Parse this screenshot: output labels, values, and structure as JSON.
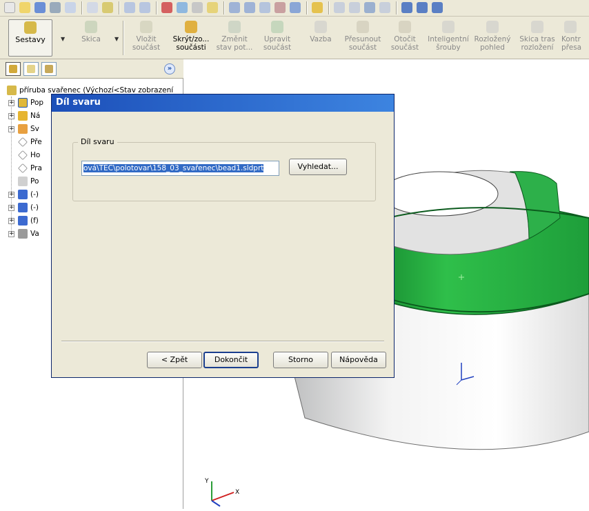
{
  "toolbar": {
    "sestavy": "Sestavy",
    "skica": "Skica",
    "items": [
      {
        "l1": "Vložit",
        "l2": "součást"
      },
      {
        "l1": "Skrýt/zo...",
        "l2": "součásti"
      },
      {
        "l1": "Změnit",
        "l2": "stav pot..."
      },
      {
        "l1": "Upravit",
        "l2": "součást"
      },
      {
        "l1": "Vazba",
        "l2": ""
      },
      {
        "l1": "Přesunout",
        "l2": "součást"
      },
      {
        "l1": "Otočit",
        "l2": "součást"
      },
      {
        "l1": "Inteligentní",
        "l2": "šrouby"
      },
      {
        "l1": "Rozložený",
        "l2": "pohled"
      },
      {
        "l1": "Skica tras",
        "l2": "rozložení"
      },
      {
        "l1": "Kontr",
        "l2": "přesa"
      }
    ]
  },
  "tree": {
    "root": "příruba svařenec (Výchozí<Stav zobrazení",
    "items": [
      {
        "label": "Pop",
        "icon": "annotations-icon"
      },
      {
        "label": "Ná",
        "icon": "design-binder-icon"
      },
      {
        "label": "Sv",
        "icon": "lights-icon"
      },
      {
        "label": "Pře",
        "icon": "plane-icon"
      },
      {
        "label": "Ho",
        "icon": "plane-icon"
      },
      {
        "label": "Pra",
        "icon": "plane-icon"
      },
      {
        "label": "Po",
        "icon": "origin-icon"
      },
      {
        "label": "(-)",
        "icon": "part-icon"
      },
      {
        "label": "(-)",
        "icon": "part-icon"
      },
      {
        "label": "(f)",
        "icon": "part-icon"
      },
      {
        "label": "Va",
        "icon": "mates-icon"
      }
    ],
    "expand_symbol": "»"
  },
  "dialog": {
    "title": "Díl svaru",
    "group_label": "Díl svaru",
    "path_value": "ová\\TEC\\polotovar\\158_03_svařenec\\bead1.sldprt",
    "browse_label": "Vyhledat...",
    "back_label": "< Zpět",
    "finish_label": "Dokončit",
    "cancel_label": "Storno",
    "help_label": "Nápověda"
  },
  "viewport": {
    "axis_x": "X",
    "axis_y": "Y",
    "accent_green": "#1f9d3a",
    "weld_color": "#22a83c"
  }
}
